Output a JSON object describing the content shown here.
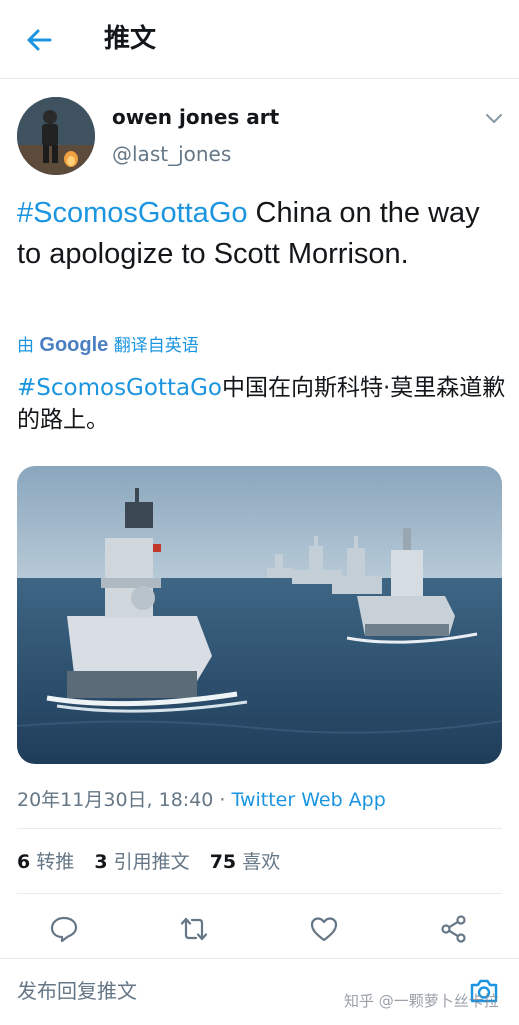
{
  "header": {
    "title": "推文"
  },
  "tweet": {
    "author_name": "owen jones art",
    "author_handle": "@last_jones",
    "hashtag": "#ScomosGottaGo",
    "text_rest": " China on the way to apologize to Scott Morrison.",
    "translate_prefix": "由",
    "translate_brand": "Google",
    "translate_suffix": "翻译自英语",
    "translated_hashtag": "#ScomosGottaGo",
    "translated_rest": "中国在向斯科特·莫里森道歉的路上。",
    "timestamp": "20年11月30日, 18:40 · ",
    "source": "Twitter Web App"
  },
  "stats": {
    "retweets_count": "6",
    "retweets_label": "转推",
    "quotes_count": "3",
    "quotes_label": "引用推文",
    "likes_count": "75",
    "likes_label": "喜欢"
  },
  "reply": {
    "placeholder": "发布回复推文"
  },
  "watermark": "知乎 @一颗萝卜丝卡拉",
  "icons": [
    "back-arrow-icon",
    "caret-down-icon",
    "reply-icon",
    "retweet-icon",
    "like-icon",
    "share-icon",
    "camera-icon"
  ],
  "colors": {
    "accent": "#1b95e0",
    "secondary_text": "#657786",
    "divider": "#e6ecf0"
  }
}
